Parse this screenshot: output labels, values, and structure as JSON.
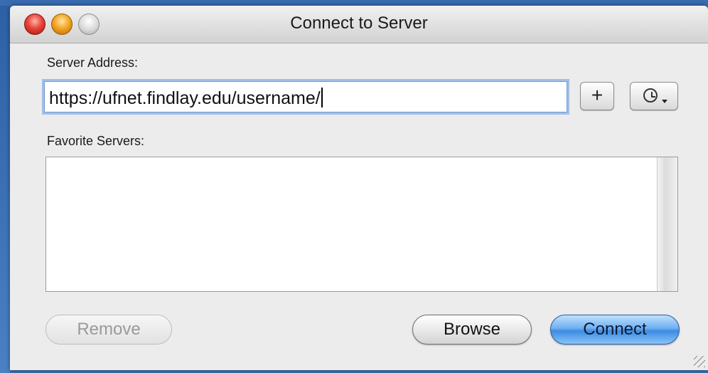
{
  "window": {
    "title": "Connect to Server"
  },
  "server_address": {
    "label": "Server Address:",
    "value": "https://ufnet.findlay.edu/username/"
  },
  "toolbar": {
    "add_favorite_label": "+",
    "recent_servers_icon": "clock-icon"
  },
  "favorites": {
    "label": "Favorite Servers:",
    "items": []
  },
  "buttons": {
    "remove_label": "Remove",
    "browse_label": "Browse",
    "connect_label": "Connect"
  },
  "colors": {
    "accent": "#6fb0f0",
    "focus_ring": "#9ec0ec",
    "close": "#e8443a",
    "minimize": "#f5a623"
  }
}
